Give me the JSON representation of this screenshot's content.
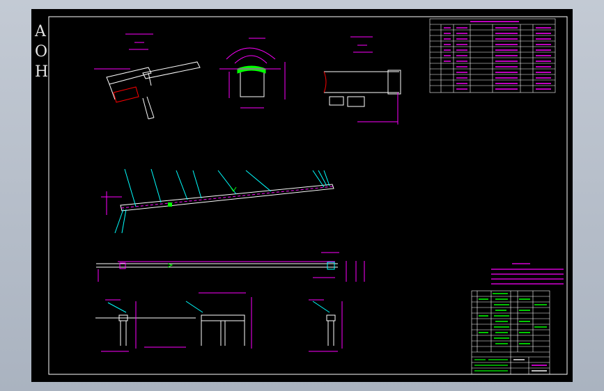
{
  "sheet": {
    "zone_letters": [
      "A",
      "O",
      "H"
    ]
  },
  "colors": {
    "background": "#000000",
    "frame": "#ffffff",
    "magenta": "#ff00ff",
    "cyan": "#00ffff",
    "green": "#00ff00",
    "red": "#ff0000",
    "app_bg": "#b7c0cc"
  }
}
